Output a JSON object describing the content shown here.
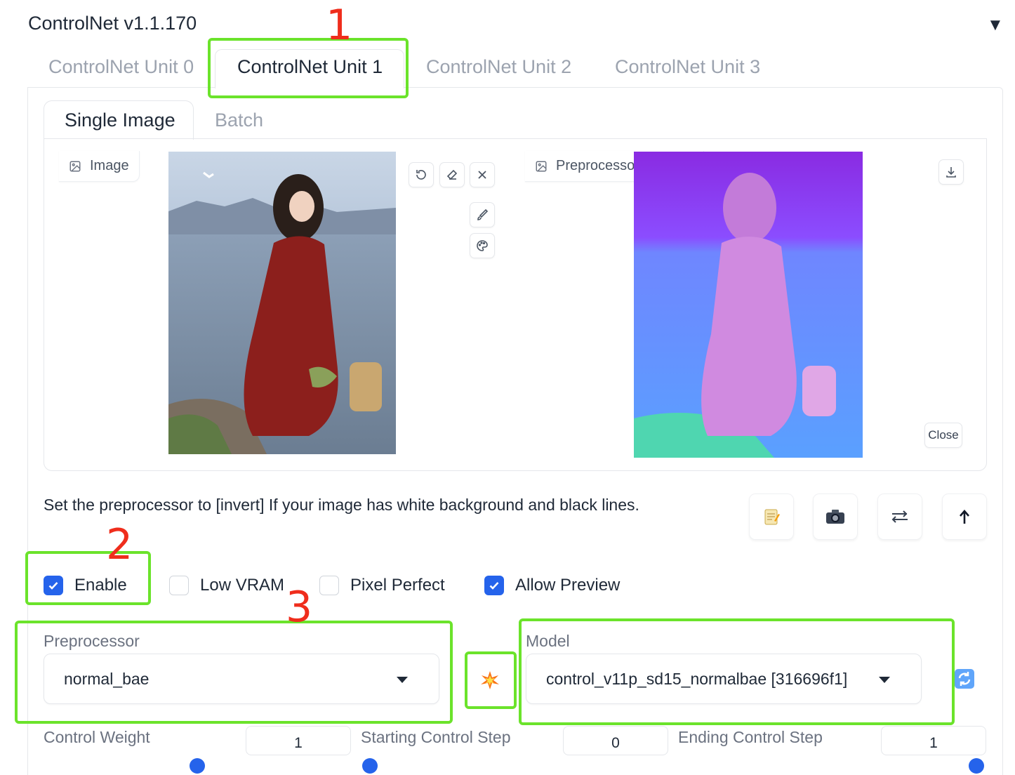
{
  "header": {
    "title": "ControlNet v1.1.170",
    "collapse_icon": "triangle-down-icon"
  },
  "unit_tabs": [
    {
      "label": "ControlNet Unit 0",
      "active": false
    },
    {
      "label": "ControlNet Unit 1",
      "active": true
    },
    {
      "label": "ControlNet Unit 2",
      "active": false
    },
    {
      "label": "ControlNet Unit 3",
      "active": false
    }
  ],
  "mode_tabs": [
    {
      "label": "Single Image",
      "active": true
    },
    {
      "label": "Batch",
      "active": false
    }
  ],
  "image_input": {
    "label": "Image",
    "tools": [
      "undo-icon",
      "eraser-icon",
      "close-icon",
      "brush-icon",
      "palette-icon"
    ]
  },
  "preprocessor_preview": {
    "label": "Preprocessor Preview",
    "download_icon": "download-icon",
    "close_label": "Close"
  },
  "hint": "Set the preprocessor to [invert] If your image has white background and black lines.",
  "action_buttons": [
    "memo-icon",
    "camera-icon",
    "swap-arrows-icon",
    "upload-arrow-icon"
  ],
  "checkboxes": [
    {
      "label": "Enable",
      "checked": true
    },
    {
      "label": "Low VRAM",
      "checked": false
    },
    {
      "label": "Pixel Perfect",
      "checked": false
    },
    {
      "label": "Allow Preview",
      "checked": true
    }
  ],
  "preprocessor": {
    "label": "Preprocessor",
    "value": "normal_bae"
  },
  "run_preprocessor_icon": "collision-icon",
  "model": {
    "label": "Model",
    "value": "control_v11p_sd15_normalbae [316696f1]"
  },
  "refresh_icon": "refresh-icon",
  "sliders": [
    {
      "label": "Control Weight",
      "value": "1"
    },
    {
      "label": "Starting Control Step",
      "value": "0"
    },
    {
      "label": "Ending Control Step",
      "value": "1"
    }
  ],
  "annotations": [
    "1",
    "2",
    "3"
  ],
  "colors": {
    "accent": "#2563eb",
    "annotation_box": "#6be32b",
    "annotation_number": "#ef2d1c"
  }
}
